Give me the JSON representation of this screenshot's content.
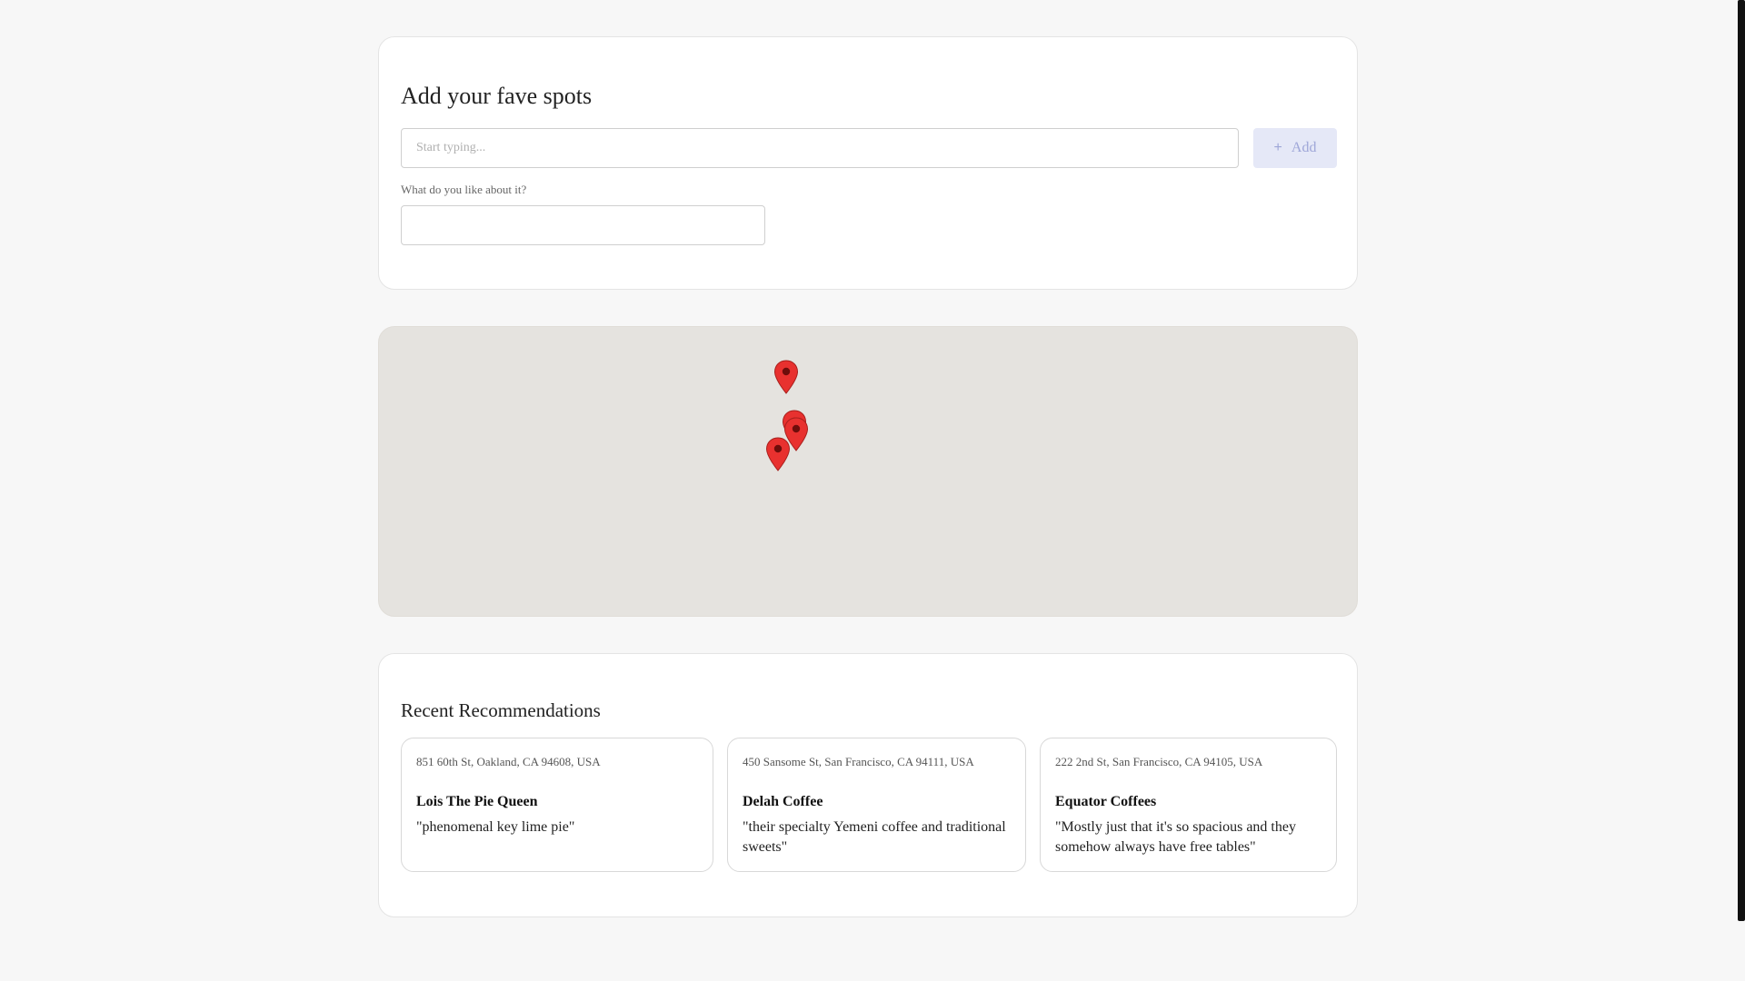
{
  "add_section": {
    "title": "Add your fave spots",
    "search_placeholder": "Start typing...",
    "search_value": "",
    "add_button_label": "Add",
    "add_button_icon": "plus-icon",
    "like_label": "What do you like about it?",
    "like_value": ""
  },
  "map": {
    "background_color": "#e5e3df",
    "marker_icon": "map-pin-icon",
    "marker_color": "#e8312f",
    "marker_count": 4
  },
  "recommendations": {
    "title": "Recent Recommendations",
    "items": [
      {
        "address": "851 60th St, Oakland, CA 94608, USA",
        "name": "Lois The Pie Queen",
        "quote": "\"phenomenal key lime pie\""
      },
      {
        "address": "450 Sansome St, San Francisco, CA 94111, USA",
        "name": "Delah Coffee",
        "quote": "\"their specialty Yemeni coffee and traditional sweets\""
      },
      {
        "address": "222 2nd St, San Francisco, CA 94105, USA",
        "name": "Equator Coffees",
        "quote": "\"Mostly just that it's so spacious and they somehow always have free tables\""
      }
    ]
  },
  "next_section": {
    "title": ""
  }
}
